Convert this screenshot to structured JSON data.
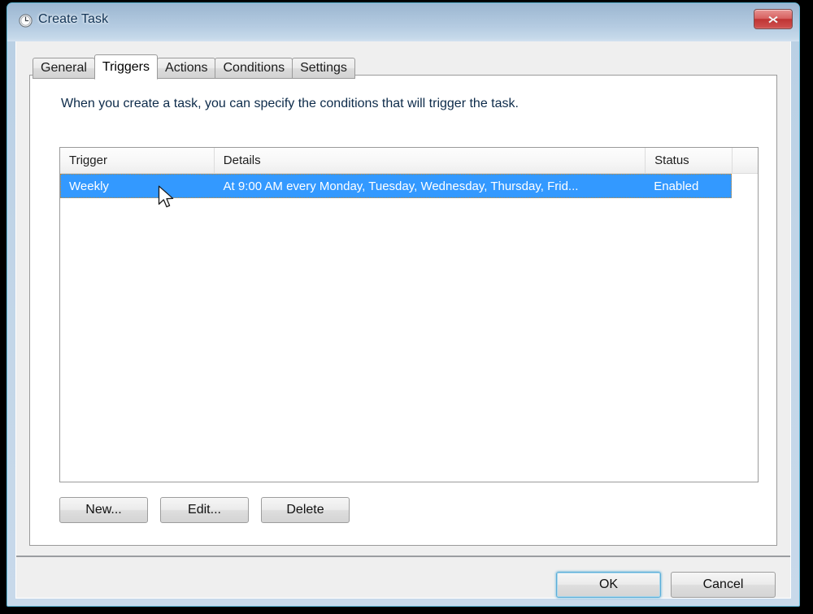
{
  "window": {
    "title": "Create Task",
    "icon": "clock-icon",
    "close_label": "Close",
    "frame_border_color": "#5fb8d8",
    "titlebar_color": "#b4cbe1"
  },
  "tabs": [
    {
      "label": "General",
      "selected": false
    },
    {
      "label": "Triggers",
      "selected": true
    },
    {
      "label": "Actions",
      "selected": false
    },
    {
      "label": "Conditions",
      "selected": false
    },
    {
      "label": "Settings",
      "selected": false
    }
  ],
  "panel": {
    "description": "When you create a task, you can specify the conditions that will trigger the task."
  },
  "trigger_list": {
    "columns": [
      "Trigger",
      "Details",
      "Status",
      ""
    ],
    "rows": [
      {
        "trigger": "Weekly",
        "details": "At 9:00 AM every Monday, Tuesday, Wednesday, Thursday, Frid...",
        "status": "Enabled",
        "selected": true
      }
    ],
    "selection_color": "#3399ff"
  },
  "action_buttons": [
    {
      "label": "New..."
    },
    {
      "label": "Edit..."
    },
    {
      "label": "Delete"
    }
  ],
  "footer_buttons": [
    {
      "label": "OK",
      "default": true
    },
    {
      "label": "Cancel",
      "default": false
    }
  ]
}
